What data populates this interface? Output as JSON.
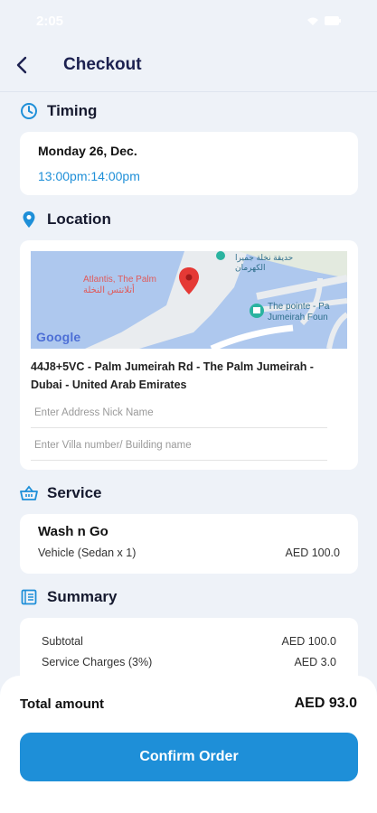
{
  "status_bar": {
    "time": "2:05"
  },
  "header": {
    "title": "Checkout"
  },
  "timing": {
    "heading": "Timing",
    "date": "Monday 26, Dec.",
    "time_slot": "13:00pm:14:00pm"
  },
  "location": {
    "heading": "Location",
    "map": {
      "pin_label": "Atlantis, The Palm",
      "pin_label_arabic": "أتلانتس النخلة",
      "poi_label_line1": "The pointe - Pa",
      "poi_label_line2": "Jumeirah Foun",
      "arabic_top_line1": "حديقة نخلة جميرا",
      "arabic_top_line2": "الكهرمان",
      "attribution": "Google"
    },
    "address": "44J8+5VC - Palm Jumeirah Rd - The Palm Jumeirah - Dubai - United Arab Emirates",
    "nickname_placeholder": "Enter Address Nick Name",
    "villa_placeholder": "Enter Villa number/ Building name"
  },
  "service": {
    "heading": "Service",
    "name": "Wash n Go",
    "vehicle": "Vehicle (Sedan x 1)",
    "price": "AED 100.0"
  },
  "summary": {
    "heading": "Summary",
    "subtotal_label": "Subtotal",
    "subtotal_value": "AED 100.0",
    "service_charges_label": "Service Charges (3%)",
    "service_charges_value": "AED 3.0"
  },
  "footer": {
    "total_label": "Total amount",
    "total_value": "AED 93.0",
    "confirm_label": "Confirm Order"
  },
  "colors": {
    "accent": "#1e8fd8",
    "title": "#1c2150",
    "background": "#eef2f8",
    "map_water": "#aec8ee",
    "pin": "#e53935"
  }
}
